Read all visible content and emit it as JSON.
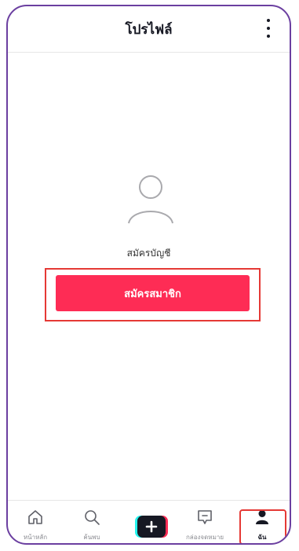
{
  "header": {
    "title": "โปรไฟล์"
  },
  "main": {
    "signup_text": "สมัครบัญชี",
    "signup_button": "สมัครสมาชิก"
  },
  "tabbar": {
    "items": [
      {
        "label": "หน้าหลัก",
        "icon": "home-icon"
      },
      {
        "label": "ค้นพบ",
        "icon": "search-icon"
      },
      {
        "label": "",
        "icon": "create-plus-icon"
      },
      {
        "label": "กล่องจดหมาย",
        "icon": "inbox-icon"
      },
      {
        "label": "ฉัน",
        "icon": "profile-icon"
      }
    ]
  },
  "colors": {
    "accent": "#fe2c55",
    "highlight_box": "#e53935",
    "frame": "#6b3fa0"
  }
}
